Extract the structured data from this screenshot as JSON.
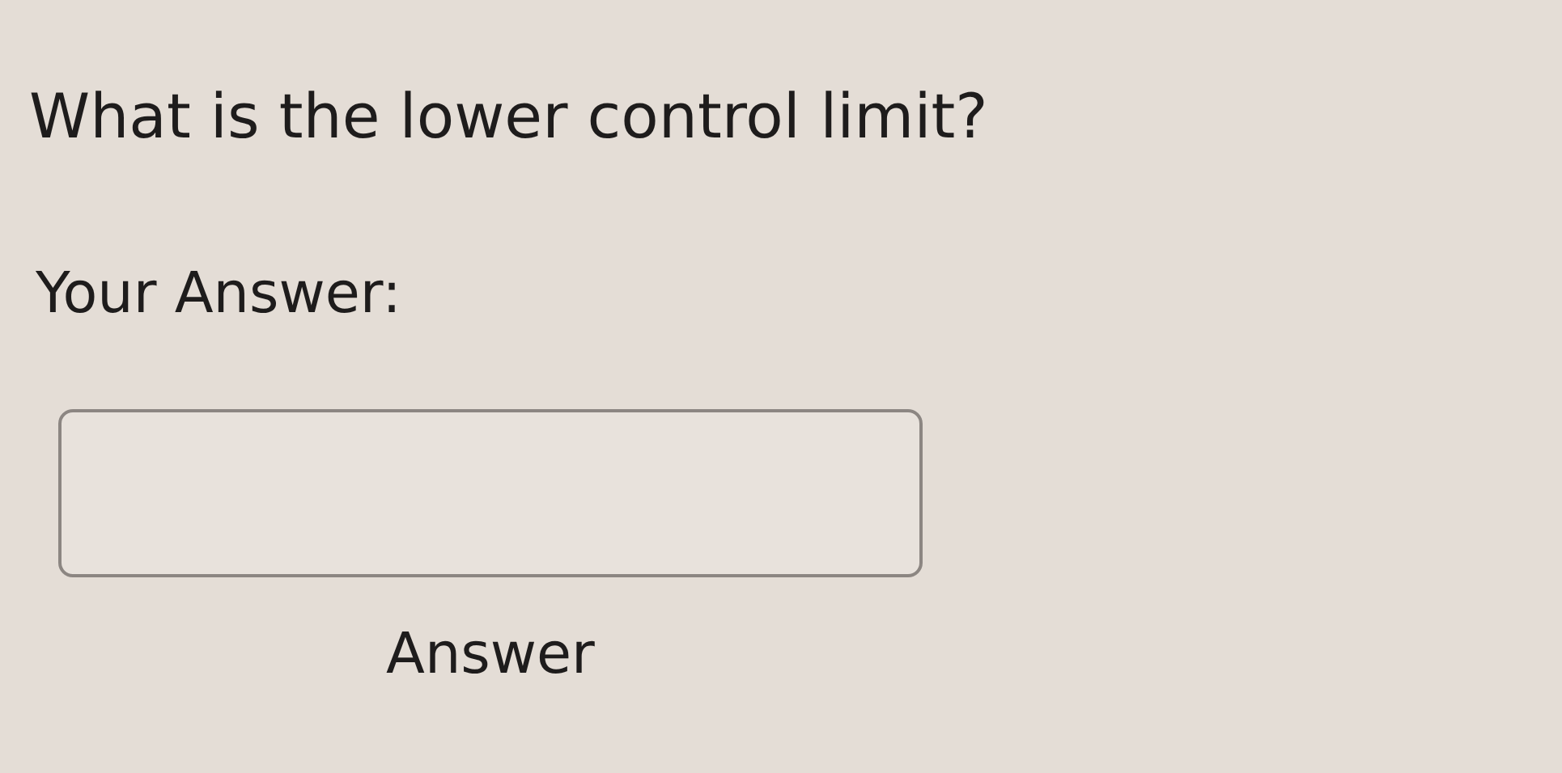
{
  "question": "What is the lower control limit?",
  "answer_label": "Your Answer:",
  "answer_field": {
    "value_caption": "Answer"
  }
}
